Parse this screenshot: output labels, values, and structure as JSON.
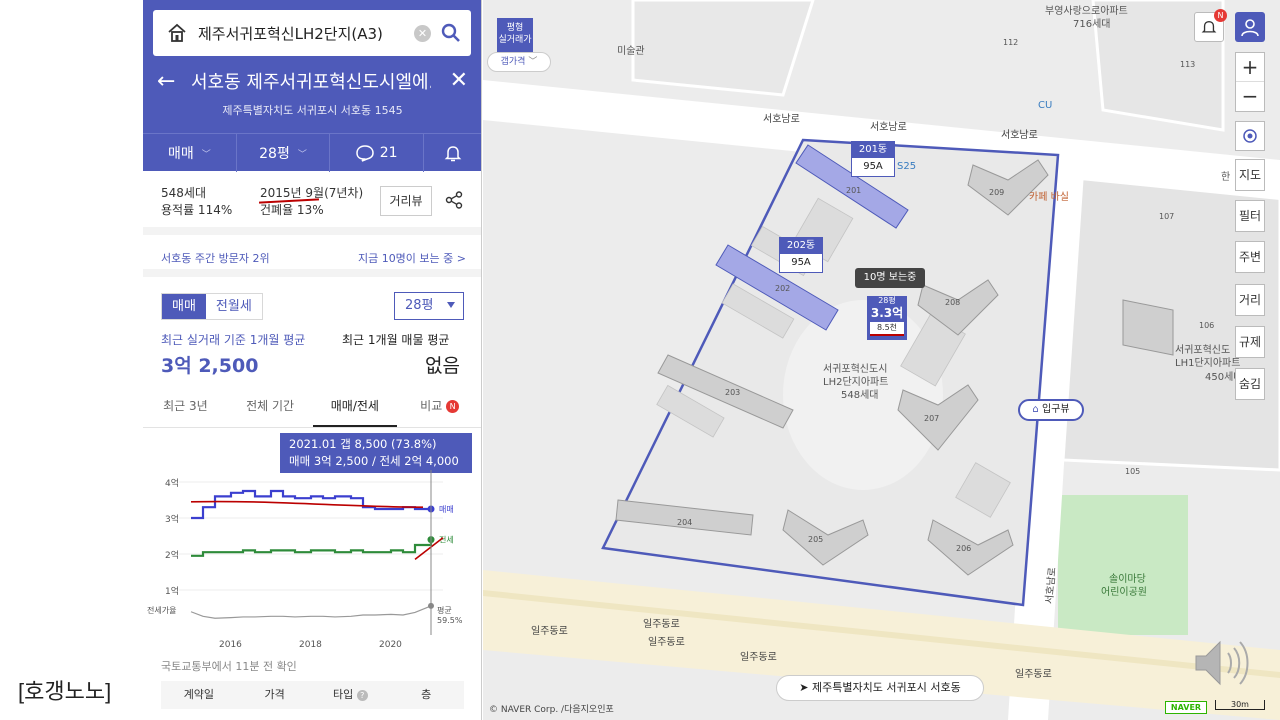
{
  "caption": "[호갱노노]",
  "search": {
    "value": "제주서귀포혁신LH2단지(A3)"
  },
  "header": {
    "title": "서호동 제주서귀포혁신도시엘에...",
    "address": "제주특별자치도 서귀포시 서호동 1545",
    "tabs": [
      {
        "label": "매매"
      },
      {
        "label": "28평"
      },
      {
        "label": "21"
      }
    ]
  },
  "info": {
    "households": "548세대",
    "far": "용적률 114%",
    "built": "2015년 9월(7년차)",
    "bcr": "건폐율 13%",
    "distview": "거리뷰"
  },
  "visit": {
    "rank": "서호동 주간 방문자 2위",
    "viewers": "지금 10명이 보는 중 >"
  },
  "price": {
    "seg": [
      "매매",
      "전월세"
    ],
    "pyeong": "28평",
    "avg_label": "최근 실거래 기준 1개월 평균",
    "avg_value": "3억 2,500",
    "listing_label": "최근 1개월 매물 평균",
    "listing_value": "없음"
  },
  "period_tabs": [
    "최근 3년",
    "전체 기간",
    "매매/전세",
    "비교"
  ],
  "period_badge": "N",
  "tooltip": {
    "line1": "2021.01  갭 8,500 (73.8%)",
    "line2": "매매 3억 2,500 / 전세 2억 4,000"
  },
  "chart_data": {
    "type": "line",
    "x": [
      2015.0,
      2015.3,
      2015.6,
      2016.0,
      2016.3,
      2016.6,
      2017.0,
      2017.3,
      2017.6,
      2018.0,
      2018.3,
      2018.6,
      2019.0,
      2019.3,
      2019.6,
      2020.0,
      2020.3,
      2020.6,
      2021.0
    ],
    "series": [
      {
        "name": "매매",
        "values": [
          3.0,
          3.3,
          3.6,
          3.7,
          3.75,
          3.6,
          3.75,
          3.6,
          3.55,
          3.6,
          3.55,
          3.6,
          3.55,
          3.3,
          3.25,
          3.25,
          3.3,
          3.25,
          3.25
        ]
      },
      {
        "name": "전세",
        "values": [
          1.95,
          2.05,
          2.05,
          2.05,
          2.1,
          2.05,
          2.1,
          2.1,
          2.05,
          2.1,
          2.1,
          2.05,
          2.1,
          2.05,
          2.05,
          2.1,
          2.05,
          2.25,
          2.4
        ]
      }
    ],
    "ylabels": [
      "4억",
      "3억",
      "2억",
      "1억"
    ],
    "xlabels": [
      "2016",
      "2018",
      "2020"
    ],
    "ylim": [
      1,
      4
    ],
    "ratio_label": "전세가율",
    "ratio_end": "평균\n59.5%",
    "ratio_values": [
      0.65,
      0.58,
      0.55,
      0.56,
      0.57,
      0.57,
      0.58,
      0.58,
      0.57,
      0.58,
      0.58,
      0.57,
      0.58,
      0.6,
      0.6,
      0.61,
      0.6,
      0.64,
      0.74
    ]
  },
  "table": {
    "source": "국토교통부에서 11분 전 확인",
    "cols": [
      "계약일",
      "가격",
      "타입",
      "층"
    ]
  },
  "map": {
    "labels": {
      "gallery": "미술관",
      "apt_top": "부영사랑으로아파트",
      "apt_top_households": "716세대",
      "cu": "CU",
      "cafe": "카페 바실",
      "complex": "서귀포혁신도시",
      "complex2": "LH2단지아파트",
      "complex3": "548세대",
      "lh1": "서귀포혁신도",
      "lh1b": "LH1단지아파트",
      "lh1c": "450세대",
      "park": "솔이마당",
      "park2": "어린이공원",
      "ps25": "S25"
    },
    "roads": [
      "서호남로",
      "서호남로",
      "서호남로",
      "서호남로",
      "일주동로",
      "일주동로",
      "일주동로",
      "일주동로",
      "일주동로"
    ],
    "buildings": [
      "201",
      "202",
      "203",
      "204",
      "205",
      "206",
      "207",
      "208",
      "209"
    ],
    "block_numbers": [
      "112",
      "113",
      "107",
      "106",
      "105"
    ],
    "realprice_flag": "평형\n실거래가",
    "gap_price": "갭가격",
    "unit201": {
      "top": "201동",
      "bot": "95A"
    },
    "unit202": {
      "top": "202동",
      "bot": "95A"
    },
    "viewers_bubble": "10명 보는중",
    "price_pin": {
      "top": "28평",
      "mid": "3.3억",
      "bot": "8.5천"
    },
    "entrance": "입구뷰",
    "location_bar": "제주특별자치도 서귀포시 서호동",
    "copyright": "© NAVER Corp. /다음지오인포",
    "scale": "30m",
    "brand": "NAVER",
    "side_buttons": [
      "지도",
      "필터",
      "주변",
      "거리",
      "규제",
      "숨김"
    ],
    "hanjeong": "한"
  }
}
